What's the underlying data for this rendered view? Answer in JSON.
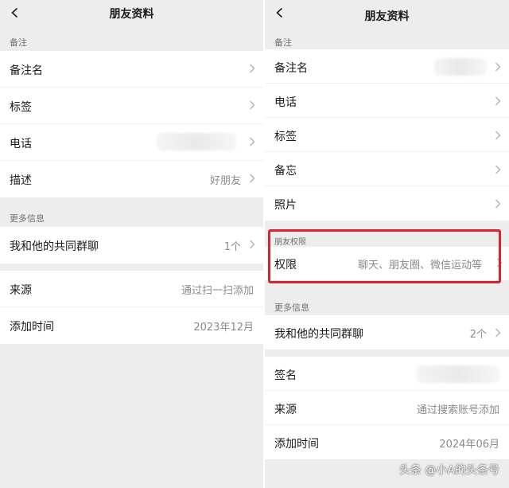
{
  "left": {
    "title": "朋友资料",
    "sections": [
      {
        "header": "备注",
        "rows": [
          {
            "label": "备注名",
            "value": ""
          },
          {
            "label": "标签",
            "value": ""
          },
          {
            "label": "电话",
            "value": ""
          },
          {
            "label": "描述",
            "value": "好朋友"
          }
        ]
      },
      {
        "header": "更多信息",
        "rows": [
          {
            "label": "我和他的共同群聊",
            "value": "1个"
          }
        ]
      },
      {
        "header": "",
        "rows": [
          {
            "label": "来源",
            "value": "通过扫一扫添加"
          },
          {
            "label": "添加时间",
            "value": "2023年12月"
          }
        ]
      }
    ]
  },
  "right": {
    "title": "朋友资料",
    "sections": [
      {
        "header": "备注",
        "rows": [
          {
            "label": "备注名",
            "value": ""
          },
          {
            "label": "电话",
            "value": ""
          },
          {
            "label": "标签",
            "value": ""
          },
          {
            "label": "备忘",
            "value": ""
          },
          {
            "label": "照片",
            "value": ""
          }
        ]
      },
      {
        "header": "朋友权限",
        "rows": [
          {
            "label": "权限",
            "value": "聊天、朋友圈、微信运动等"
          }
        ]
      },
      {
        "header": "更多信息",
        "rows": [
          {
            "label": "我和他的共同群聊",
            "value": "2个"
          }
        ]
      },
      {
        "header": "",
        "rows": [
          {
            "label": "签名",
            "value": ""
          },
          {
            "label": "来源",
            "value": "通过搜索账号添加"
          },
          {
            "label": "添加时间",
            "value": "2024年06月"
          }
        ]
      }
    ]
  },
  "watermark": "头条 @小A的头条号",
  "colors": {
    "background": "#ededed",
    "card": "#ffffff",
    "highlight": "#d9232d",
    "secondary_text": "#8a8a8a"
  },
  "icons": {
    "back": "chevron-left-icon",
    "row_arrow": "chevron-right-icon"
  }
}
